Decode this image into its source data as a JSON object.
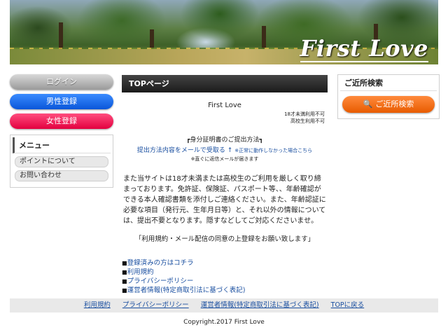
{
  "header": {
    "site_title": "First Love"
  },
  "left": {
    "login_label": "ログイン",
    "male_register_label": "男性登録",
    "female_register_label": "女性登録",
    "menu_title": "メニュー",
    "menu_items": [
      "ポイントについて",
      "お問い合わせ"
    ]
  },
  "main": {
    "section_title": "TOPページ",
    "site_name": "First Love",
    "age_notes": [
      "18才未満利用不可",
      "高校生利用不可"
    ],
    "id_title": "┏身分証明書のご提出方法┓",
    "id_link": "提出方法内容をメールで受取る ↑",
    "id_link_note": "※正常に動作しなかった場合こちら",
    "id_note2": "※直ぐに返信メールが届きます",
    "notice": "また当サイトは18才未満または高校生のご利用を厳しく取り締まっております。免許証、保険証、パスポート等、、年齢確認ができる本人確認書類を添付しご連絡ください。また、年齢認証に必要な項目（発行元、生年月日等）と、それ以外の情報については、提出不要となります。隠すなどしてご対応くださいませ。",
    "agree": "「利用規約・メール配信の同意の上登録をお願い致します」",
    "links": [
      "登録済みの方はコチラ",
      "利用規約",
      "プライバシーポリシー",
      "運営者情報(特定商取引法に基づく表記)"
    ]
  },
  "right": {
    "nearby_title": "ご近所検索",
    "search_label": "ご近所検索"
  },
  "footer": {
    "links": [
      "利用規約",
      "プライバシーポリシー",
      "運営者情報(特定商取引法に基づく表記)",
      "TOPに戻る"
    ],
    "copyright": "Copyright.2017 First Love"
  }
}
